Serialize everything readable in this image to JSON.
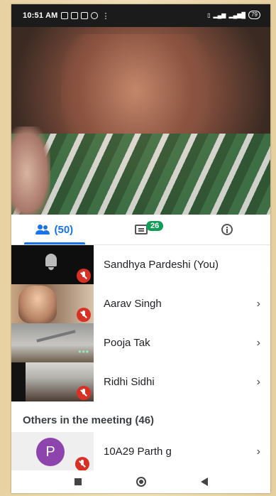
{
  "status_bar": {
    "time": "10:51 AM",
    "battery": "79"
  },
  "tabs": {
    "people_count": "(50)",
    "chat_badge": "26"
  },
  "participants": [
    {
      "name": "Sandhya Pardeshi (You)",
      "muted": true,
      "has_chevron": false
    },
    {
      "name": "Aarav Singh",
      "muted": true,
      "has_chevron": true
    },
    {
      "name": "Pooja Tak",
      "muted": false,
      "has_chevron": true
    },
    {
      "name": "Ridhi Sidhi",
      "muted": true,
      "has_chevron": true
    }
  ],
  "others": {
    "heading": "Others in the meeting (46)",
    "items": [
      {
        "avatar_letter": "P",
        "name": "10A29 Parth g",
        "muted": true
      }
    ]
  },
  "chevron": "›",
  "more_dots": "•••",
  "colors": {
    "accent": "#1a73e8",
    "mute_red": "#d93025",
    "badge_green": "#0f9d58",
    "avatar_purple": "#8e44ad"
  }
}
